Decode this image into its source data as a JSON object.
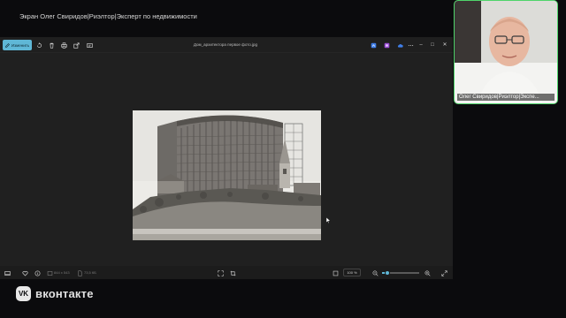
{
  "stream": {
    "title": "Экран Олег Свиридов|Риэлтор|Эксперт по недвижимости"
  },
  "viewer": {
    "edit_label": "Изменить",
    "file_name": "Дом_архитектора первое фото.jpg",
    "toolbar_icons": [
      "rotate-icon",
      "delete-icon",
      "print-icon",
      "share-icon",
      "more-icon"
    ],
    "right_icons": [
      "collection-icon",
      "copilot-icon",
      "cloud-icon",
      "more-options-icon"
    ],
    "window_controls": {
      "minimize": "–",
      "maximize": "□",
      "close": "✕"
    }
  },
  "status": {
    "dimensions": "844 x 543",
    "size": "73,5 КБ",
    "zoom": "100 %",
    "zoom_fraction": 0.15
  },
  "camera": {
    "label": "Олег Свиридов|Риэлтор|Экспе..."
  },
  "brand": {
    "logo_text": "VK",
    "name": "вконтакте"
  },
  "colors": {
    "accent": "#5fb7d6",
    "camera_border": "#4fd46a"
  }
}
